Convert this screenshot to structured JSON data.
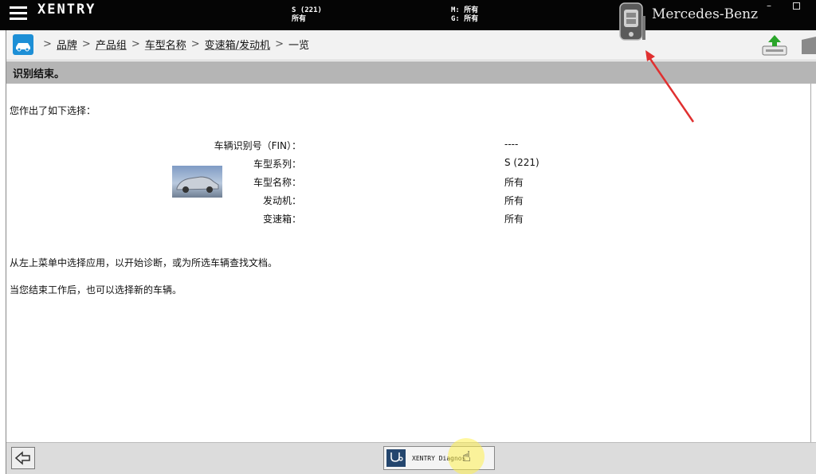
{
  "topbar": {
    "brand": "XENTRY",
    "vehicle_series": "S (221)",
    "vehicle_model": "所有",
    "engine_label": "M: 所有",
    "transmission_label": "G: 所有",
    "mb_brand": "Mercedes-Benz",
    "minimize": "–"
  },
  "breadcrumb": {
    "items": [
      "品牌",
      "产品组",
      "车型名称",
      "变速箱/发动机"
    ],
    "current": "一览"
  },
  "title": "识别结束。",
  "intro": "您作出了如下选择：",
  "selection": [
    {
      "label": "车辆识别号（FIN）：",
      "value": "----"
    },
    {
      "label": "车型系列：",
      "value": "S (221)"
    },
    {
      "label": "车型名称：",
      "value": "所有"
    },
    {
      "label": "发动机：",
      "value": "所有"
    },
    {
      "label": "变速箱：",
      "value": "所有"
    }
  ],
  "hint1": "从左上菜单中选择应用，以开始诊断，或为所选车辆查找文档。",
  "hint2": "当您结束工作后，也可以选择新的车辆。",
  "footer": {
    "diag_label": "XENTRY Diagnos"
  },
  "colors": {
    "topbar": "#050505",
    "titlebar": "#b5b5b5",
    "home_blue": "#1d8fd6",
    "arrow_red": "#e03030"
  }
}
